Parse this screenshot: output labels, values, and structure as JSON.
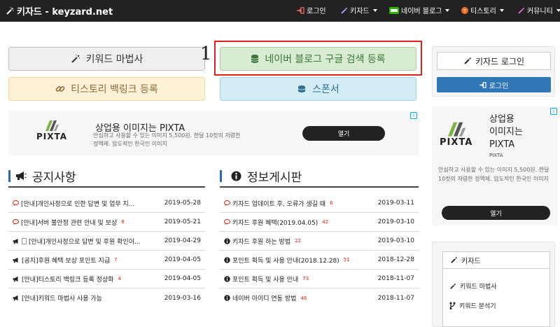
{
  "navbar": {
    "brand": "키자드 - keyzard.net",
    "items": [
      {
        "label": "로그인",
        "icon": "sign-in-icon",
        "dropdown": false
      },
      {
        "label": "키자드",
        "icon": "magic-wand-icon",
        "dropdown": true
      },
      {
        "label": "네이버 블로그",
        "icon": "naver-blog-icon",
        "dropdown": true
      },
      {
        "label": "티스토리",
        "icon": "tistory-icon",
        "dropdown": true
      },
      {
        "label": "커뮤니티",
        "icon": "community-icon",
        "dropdown": true
      }
    ]
  },
  "buttons": {
    "wizard": "키워드 마법사",
    "naver_search": "네이버 블로그 구글 검색 등록",
    "tistory_backlink": "티스토리 백링크 등록",
    "sponsor": "스폰서"
  },
  "annotation": {
    "number": "1"
  },
  "ad_main": {
    "brand": "PIXTA",
    "title": "상업용 이미지는 PIXTA",
    "text_line1": "안심하고 사용할 수 있는 이미지 5,500원. 한달 10컷의 저렴한",
    "text_line2": "정액제. 압도적인 한국인 이미지",
    "button": "열기"
  },
  "notice": {
    "title": "공지사항",
    "rows": [
      {
        "title": "[안내]개인사정으로 인한 답변 및 업무 지...",
        "count": "",
        "date": "2019-05-28",
        "icon": "comment-icon"
      },
      {
        "title": "[안내]서버 불안정 관련 안내 및 보상",
        "count": "8",
        "date": "2019-05-21",
        "icon": "comment-icon"
      },
      {
        "title": "[안내]개인사정으로 답변 및 후원 확인이...",
        "count": "",
        "date": "2019-04-29",
        "icon": "megaphone-icon"
      },
      {
        "title": "[공지]후원 혜택 보상 포인트 지급",
        "count": "7",
        "date": "2019-04-05",
        "icon": "megaphone-icon"
      },
      {
        "title": "[안내]티스토리 백링크 등록 정상화",
        "count": "4",
        "date": "2019-04-05",
        "icon": "megaphone-icon"
      },
      {
        "title": "[안내]키워드 마법사 사용 가능",
        "count": "",
        "date": "2019-03-16",
        "icon": "megaphone-icon"
      }
    ]
  },
  "board": {
    "title": "정보게시판",
    "rows": [
      {
        "title": "키자드 업데이트 후, 오류가 생길 때",
        "count": "6",
        "date": "2019-03-11",
        "icon": "comment-icon"
      },
      {
        "title": "키자드 후원 혜택(2019.04.05)",
        "count": "42",
        "date": "2019-03-10",
        "icon": "comment-icon"
      },
      {
        "title": "키자드 후원 하는 방법",
        "count": "22",
        "date": "2019-03-10",
        "icon": "info-icon"
      },
      {
        "title": "포인트 획득 및 사용 안내(2018.12.28)",
        "count": "51",
        "date": "2018-12-28",
        "icon": "info-icon"
      },
      {
        "title": "포인트 획득 및 사용 안내",
        "count": "73",
        "date": "2018-11-07",
        "icon": "info-icon"
      },
      {
        "title": "네이버 아이디 연동 방법",
        "count": "46",
        "date": "2018-11-07",
        "icon": "info-icon"
      }
    ]
  },
  "login_panel": {
    "title": "키자드 로그인",
    "button": "로그인"
  },
  "ad_side": {
    "title_line1": "상업용",
    "title_line2": "이미지는",
    "title_line3": "PIXTA",
    "brand_small": "PIXTA",
    "logo": "PIXTA",
    "text": "안심하고 사용할 수 있는 이미지 5,500원. 한달 10컷의 저렴한 정액제. 압도적인 한국인 이미지",
    "button": "열기"
  },
  "keyzard_panel": {
    "title": "키자드",
    "items": [
      "키워드 마법사",
      "키워드 분석기"
    ]
  },
  "colors": {
    "navbar": "#222222",
    "naver_button": "#d7ecd0",
    "tistory_button": "#fcf1d6",
    "sponsor_button": "#d4ecf5",
    "primary": "#2f77b6",
    "highlight": "#e0231b",
    "count": "#d9230f"
  }
}
